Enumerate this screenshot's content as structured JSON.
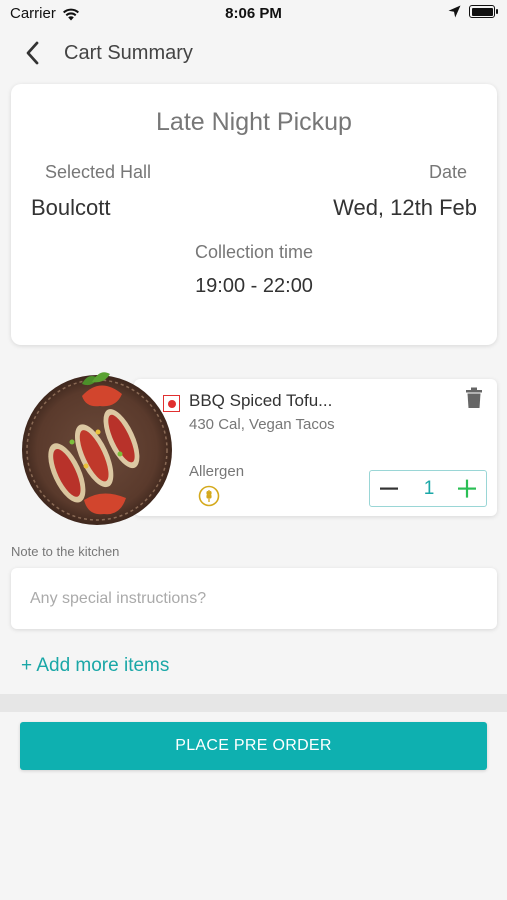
{
  "status_bar": {
    "carrier": "Carrier",
    "time": "8:06 PM",
    "battery_level": 1.0
  },
  "header": {
    "title": "Cart Summary",
    "back_icon": "chevron-left-icon"
  },
  "summary": {
    "title": "Late Night Pickup",
    "hall_label": "Selected Hall",
    "hall_value": "Boulcott",
    "date_label": "Date",
    "date_value": "Wed, 12th Feb",
    "collection_label": "Collection time",
    "collection_value": "19:00 - 22:00"
  },
  "cart_item": {
    "name": "BBQ Spiced Tofu...",
    "details": "430 Cal, Vegan Tacos",
    "allergen_label": "Allergen",
    "quantity": "1",
    "veg_marker_color": "#e03030",
    "allergen_icon": "wheat-icon"
  },
  "notes": {
    "label": "Note to the kitchen",
    "placeholder": "Any special instructions?",
    "value": ""
  },
  "actions": {
    "add_more": "+ Add more items",
    "place_order": "PLACE PRE ORDER"
  },
  "colors": {
    "accent": "#0eb0b0",
    "background": "#f5f5f5"
  }
}
